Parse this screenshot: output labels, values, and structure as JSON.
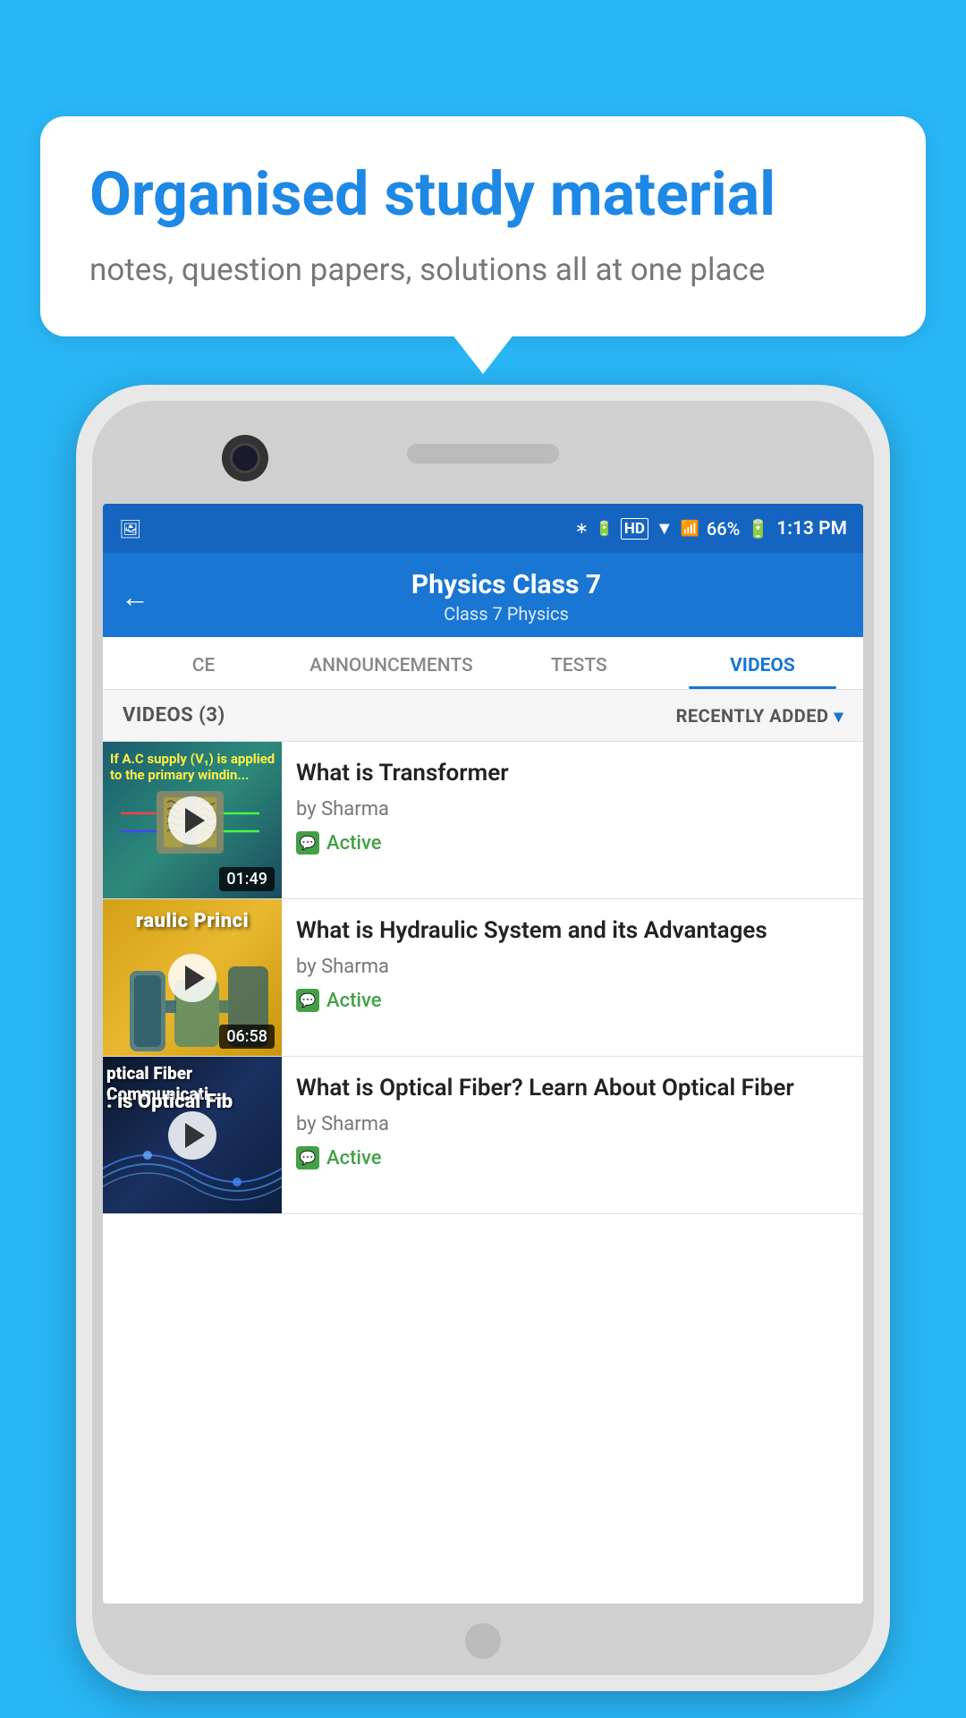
{
  "background": {
    "color": "#29b6f6"
  },
  "speech_bubble": {
    "title": "Organised study material",
    "subtitle": "notes, question papers, solutions all at one place"
  },
  "phone": {
    "status_bar": {
      "time": "1:13 PM",
      "battery": "66%",
      "signal": "HD"
    },
    "header": {
      "title": "Physics Class 7",
      "breadcrumb": "Class 7    Physics",
      "back_label": "←"
    },
    "tabs": [
      {
        "label": "CE",
        "active": false
      },
      {
        "label": "ANNOUNCEMENTS",
        "active": false
      },
      {
        "label": "TESTS",
        "active": false
      },
      {
        "label": "VIDEOS",
        "active": true
      }
    ],
    "list_header": {
      "count": "VIDEOS (3)",
      "sort": "RECENTLY ADDED"
    },
    "videos": [
      {
        "title": "What is  Transformer",
        "author": "by Sharma",
        "status": "Active",
        "duration": "01:49",
        "thumb_type": "transformer"
      },
      {
        "title": "What is Hydraulic System and its Advantages",
        "author": "by Sharma",
        "status": "Active",
        "duration": "06:58",
        "thumb_type": "hydraulic"
      },
      {
        "title": "What is Optical Fiber? Learn About Optical Fiber",
        "author": "by Sharma",
        "status": "Active",
        "duration": "",
        "thumb_type": "optical"
      }
    ]
  }
}
